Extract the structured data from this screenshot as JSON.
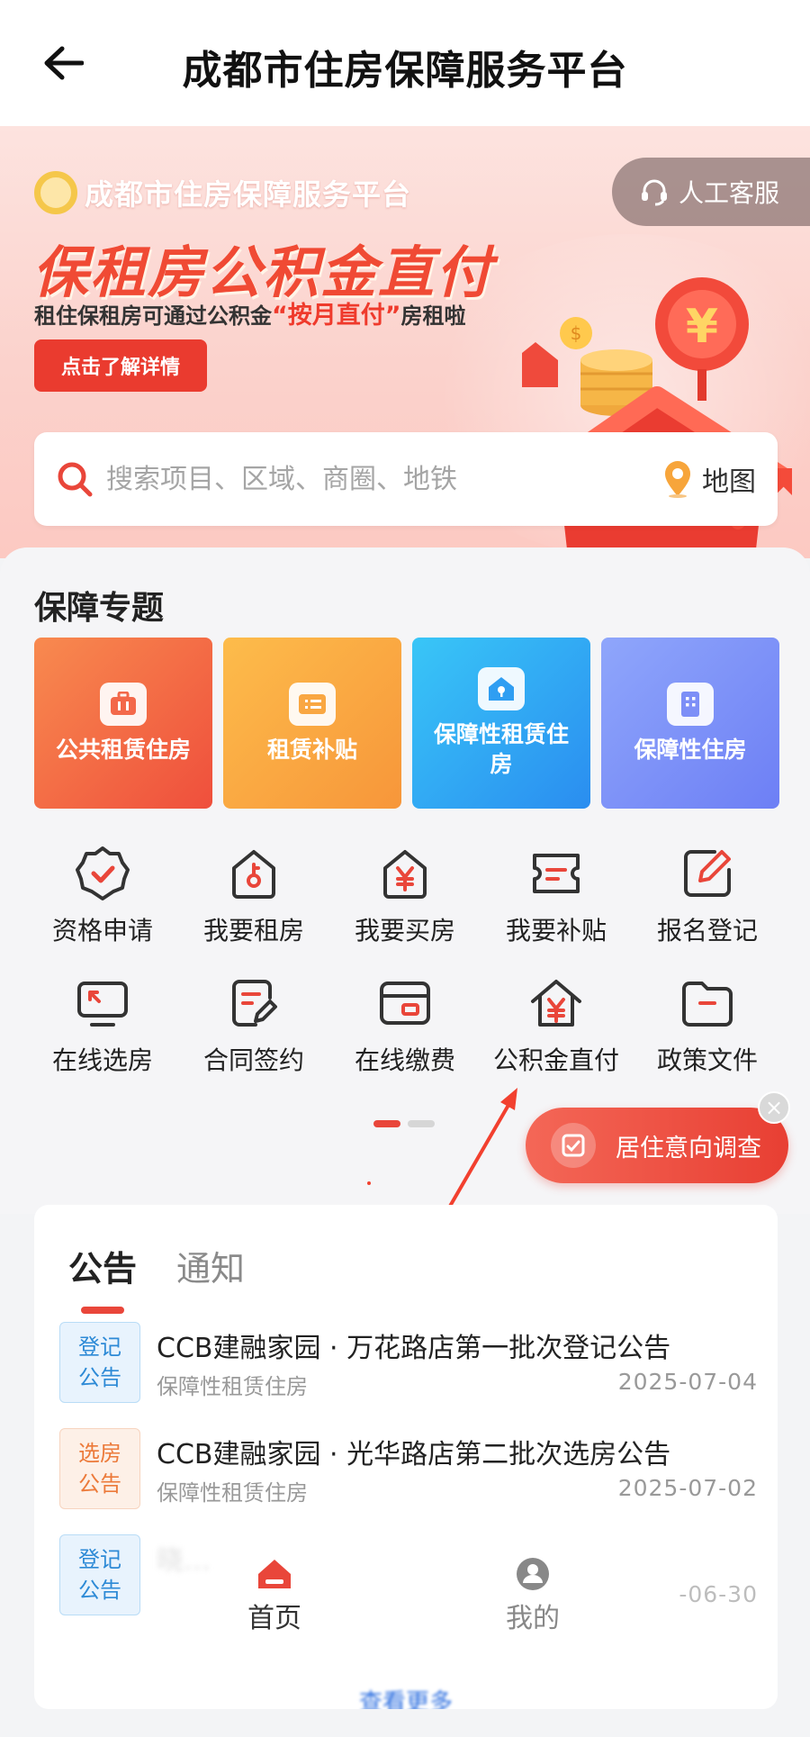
{
  "header": {
    "title": "成都市住房保障服务平台"
  },
  "banner": {
    "brand": "成都市住房保障服务平台",
    "service_label": "人工客服",
    "headline": "保租房公积金直付",
    "sub_prefix": "租住保租房可通过公积金",
    "sub_highlight": "“按月直付”",
    "sub_suffix": "房租啦",
    "detail_label": "点击了解详情"
  },
  "search": {
    "placeholder": "搜索项目、区域、商圈、地铁",
    "map_label": "地图"
  },
  "topics": {
    "title": "保障专题",
    "items": [
      {
        "label": "公共租赁住房"
      },
      {
        "label": "租赁补贴"
      },
      {
        "label": "保障性租赁住房"
      },
      {
        "label": "保障性住房"
      }
    ]
  },
  "services": [
    {
      "label": "资格申请",
      "icon": "badge-check-icon"
    },
    {
      "label": "我要租房",
      "icon": "house-key-icon"
    },
    {
      "label": "我要买房",
      "icon": "house-yen-icon"
    },
    {
      "label": "我要补贴",
      "icon": "ticket-icon"
    },
    {
      "label": "报名登记",
      "icon": "edit-icon"
    },
    {
      "label": "在线选房",
      "icon": "monitor-icon"
    },
    {
      "label": "合同签约",
      "icon": "contract-icon"
    },
    {
      "label": "在线缴费",
      "icon": "card-icon"
    },
    {
      "label": "公积金直付",
      "icon": "house-yen-icon"
    },
    {
      "label": "政策文件",
      "icon": "folder-icon"
    }
  ],
  "pager": {
    "pages": 2,
    "current": 1
  },
  "survey": {
    "label": "居住意向调查"
  },
  "notices": {
    "tabs": [
      "公告",
      "通知"
    ],
    "active_tab": "公告",
    "items": [
      {
        "badge_line1": "登记",
        "badge_line2": "公告",
        "badge_color": "blue",
        "title": "CCB建融家园 · 万花路店第一批次登记公告",
        "category": "保障性租赁住房",
        "date": "2025-07-04"
      },
      {
        "badge_line1": "选房",
        "badge_line2": "公告",
        "badge_color": "orange",
        "title": "CCB建融家园 · 光华路店第二批次选房公告",
        "category": "保障性租赁住房",
        "date": "2025-07-02"
      },
      {
        "badge_line1": "登记",
        "badge_line2": "公告",
        "badge_color": "blue",
        "title": "晓…",
        "category": "",
        "date": "-06-30"
      }
    ],
    "more_label": "查看更多"
  },
  "bottom_nav": {
    "home": "首页",
    "mine": "我的"
  },
  "colors": {
    "primary": "#e9463a",
    "link": "#2d6fe0"
  }
}
